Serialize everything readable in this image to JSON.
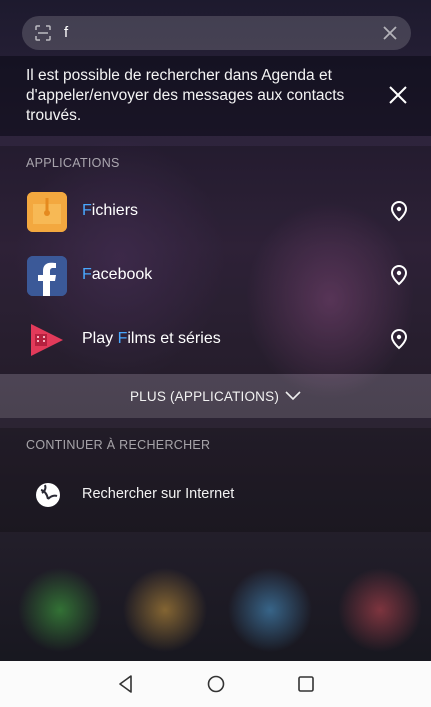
{
  "search": {
    "query": "f"
  },
  "hint": {
    "text": "Il est possible de rechercher dans Agenda et d'appeler/envoyer des messages aux contacts trouvés."
  },
  "applications": {
    "title": "APPLICATIONS",
    "items": [
      {
        "match": "F",
        "rest": "ichiers",
        "icon": "files-app-icon"
      },
      {
        "match": "F",
        "rest": "acebook",
        "icon": "facebook-app-icon"
      },
      {
        "prefix": "Play ",
        "match": "F",
        "rest": "ilms et séries",
        "icon": "play-films-app-icon"
      }
    ],
    "more_label": "PLUS (APPLICATIONS)"
  },
  "continue": {
    "title": "CONTINUER À RECHERCHER",
    "web_label": "Rechercher sur Internet"
  },
  "colors": {
    "highlight": "#49a8ff",
    "files_orange": "#f0a23a",
    "facebook_blue": "#3b5998",
    "play_films_red": "#e23a5a"
  },
  "icons": {
    "search_bar_left": "scan-icon",
    "search_bar_right": "clear-icon",
    "hint_close": "close-icon",
    "pin": "location-pin-icon",
    "more": "chevron-down-icon",
    "web": "globe-icon",
    "nav": [
      "back-icon",
      "home-icon",
      "recents-icon"
    ]
  }
}
